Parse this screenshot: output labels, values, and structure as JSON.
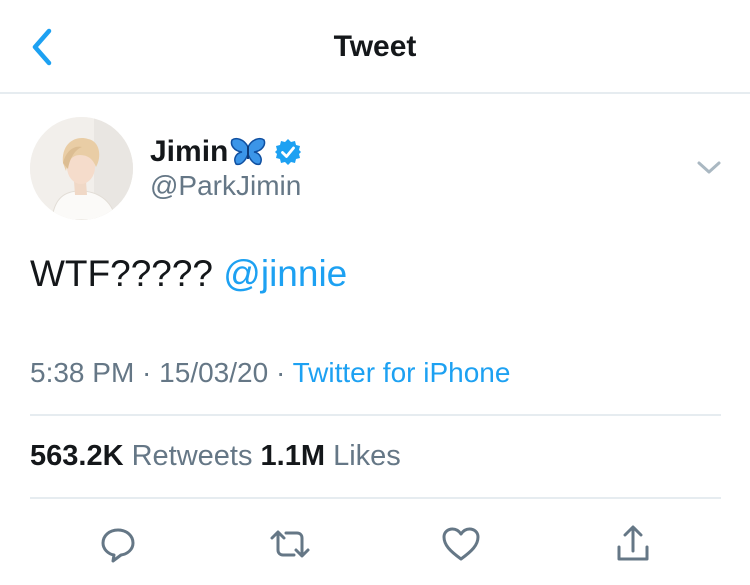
{
  "header": {
    "title": "Tweet",
    "back_icon": "chevron-left-icon",
    "accent": "#1da1f2"
  },
  "author": {
    "name": "Jimin",
    "name_emoji_icon": "butterfly-icon",
    "verified_icon": "verified-badge-icon",
    "handle": "@ParkJimin",
    "avatar": "profile-photo"
  },
  "tweet": {
    "text": "WTF?????",
    "mention": "@jinnie"
  },
  "meta": {
    "time": "5:38 PM",
    "separator1": " · ",
    "date": "15/03/20",
    "separator2": " · ",
    "source": "Twitter for iPhone"
  },
  "stats": {
    "retweets_count": "563.2K",
    "retweets_label": "Retweets",
    "likes_count": "1.1M",
    "likes_label": "Likes"
  },
  "actions": [
    {
      "name": "reply",
      "icon": "reply-icon"
    },
    {
      "name": "retweet",
      "icon": "retweet-icon"
    },
    {
      "name": "like",
      "icon": "heart-icon"
    },
    {
      "name": "share",
      "icon": "share-icon"
    }
  ],
  "colors": {
    "primary_text": "#14171a",
    "secondary_text": "#657786",
    "link": "#1da1f2",
    "divider": "#e6ecf0"
  }
}
